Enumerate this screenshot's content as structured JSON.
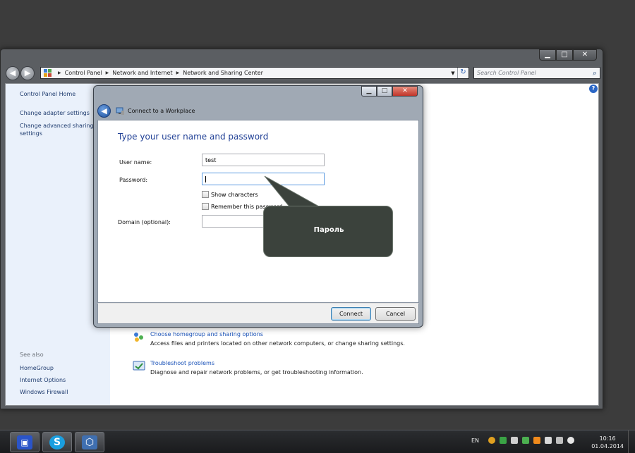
{
  "explorer": {
    "caption_buttons": {
      "minimize": "▁",
      "maximize": "□",
      "close": "✕"
    },
    "breadcrumbs": [
      "Control Panel",
      "Network and Internet",
      "Network and Sharing Center"
    ],
    "search_placeholder": "Search Control Panel",
    "sidebar": {
      "items": [
        "Control Panel Home",
        "Change adapter settings",
        "Change advanced sharing settings"
      ],
      "see_also_label": "See also",
      "see_also_items": [
        "HomeGroup",
        "Internet Options",
        "Windows Firewall"
      ]
    },
    "tasks": [
      {
        "link": "Choose homegroup and sharing options",
        "desc": "Access files and printers located on other network computers, or change sharing settings.",
        "icon": "homegroup-icon"
      },
      {
        "link": "Troubleshoot problems",
        "desc": "Diagnose and repair network problems, or get troubleshooting information.",
        "icon": "troubleshoot-icon"
      }
    ]
  },
  "dialog": {
    "title": "Connect to a Workplace",
    "heading": "Type your user name and password",
    "fields": {
      "username_label": "User name:",
      "username_value": "test",
      "password_label": "Password:",
      "password_value": "",
      "domain_label": "Domain (optional):",
      "domain_value": ""
    },
    "checkboxes": {
      "show_characters": "Show characters",
      "remember_password": "Remember this password"
    },
    "buttons": {
      "connect": "Connect",
      "cancel": "Cancel"
    }
  },
  "callout": {
    "text": "Пароль"
  },
  "taskbar": {
    "apps": [
      {
        "name": "save-app",
        "glyph": "💾",
        "color": "#2a54c8"
      },
      {
        "name": "skype-app",
        "glyph": "S",
        "color": "#1a9fe0"
      },
      {
        "name": "virtualbox-app",
        "glyph": "⬡",
        "color": "#3f6fb0"
      }
    ],
    "language": "EN",
    "time": "10:16",
    "date": "01.04.2014"
  },
  "colors": {
    "accent_link": "#1a52b8",
    "dialog_heading": "#1f3f95",
    "callout_bg": "#3b423c"
  }
}
